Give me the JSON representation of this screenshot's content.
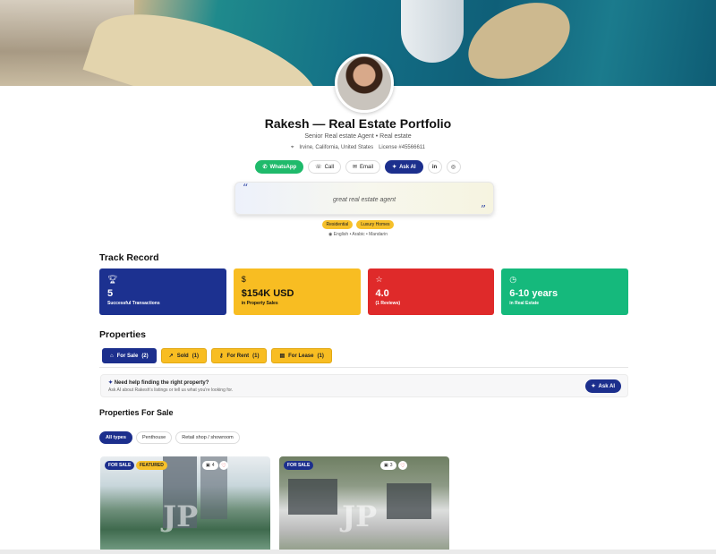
{
  "profile": {
    "name": "Rakesh — Real Estate Portfolio",
    "subtitle": "Senior Real estate Agent • Real estate",
    "location": "Irvine, California, United States",
    "license": "License #45566611"
  },
  "actions": {
    "whatsapp": "WhatsApp",
    "call": "Call",
    "email": "Email",
    "ask_ai": "Ask AI",
    "linkedin_icon": "in"
  },
  "quote": {
    "text": "great real estate agent"
  },
  "tags": [
    "Residential",
    "Luxury Homes"
  ],
  "languages": "English • Arabic • Mandarin",
  "track_record": {
    "heading": "Track Record",
    "stats": [
      {
        "value": "5",
        "label": "Successful Transactions",
        "color": "#1c3190",
        "icon": "trophy-icon"
      },
      {
        "value": "$154K USD",
        "label": "in Property Sales",
        "color": "#f8bd22",
        "icon": "dollar-icon"
      },
      {
        "value": "4.0",
        "label": "(1 Reviews)",
        "color": "#df2a2a",
        "icon": "star-icon"
      },
      {
        "value": "6-10 years",
        "label": "in Real Estate",
        "color": "#15b97c",
        "icon": "clock-icon"
      }
    ]
  },
  "properties": {
    "heading": "Properties",
    "tabs": [
      {
        "label": "For Sale",
        "count": "(2)"
      },
      {
        "label": "Sold",
        "count": "(1)"
      },
      {
        "label": "For Rent",
        "count": "(1)"
      },
      {
        "label": "For Lease",
        "count": "(1)"
      }
    ],
    "help_title": "Need help finding the right property?",
    "help_sub": "Ask AI about Rakesh's listings or tell us what you're looking for.",
    "help_button": "Ask AI",
    "for_sale_heading": "Properties For Sale",
    "filters": [
      "All types",
      "Penthouse",
      "Retail shop / showroom"
    ],
    "cards": [
      {
        "status": "FOR SALE",
        "featured": "FEATURED",
        "photos": "4",
        "watermark": "JP"
      },
      {
        "status": "FOR SALE",
        "photos": "3",
        "watermark": "JP"
      }
    ]
  }
}
